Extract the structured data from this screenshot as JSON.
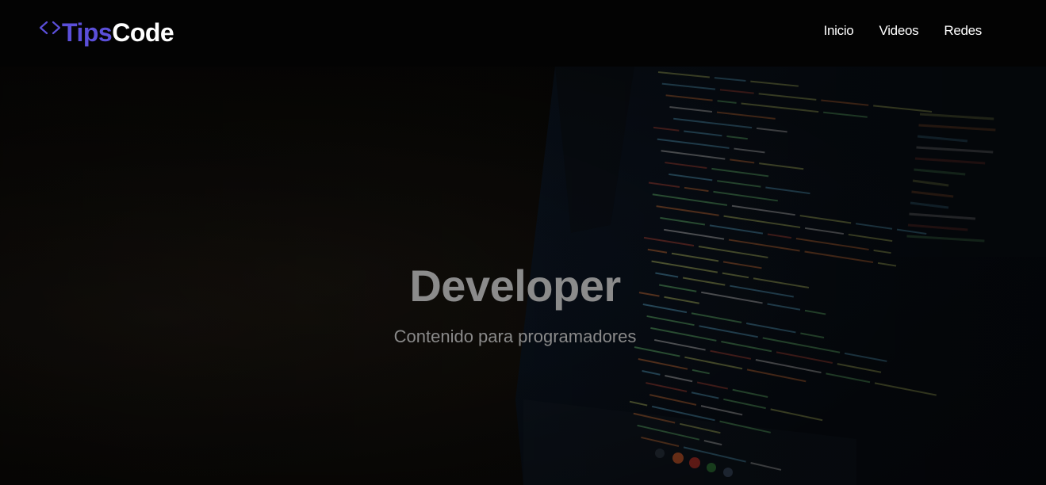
{
  "brand": {
    "icon": "code-brackets-icon",
    "name_part1": "Tips",
    "name_part2": "Code",
    "accent_color": "#5b4fd9"
  },
  "nav": {
    "items": [
      {
        "label": "Inicio"
      },
      {
        "label": "Videos"
      },
      {
        "label": "Redes"
      }
    ]
  },
  "hero": {
    "title": "Developer",
    "subtitle": "Contenido para programadores",
    "background": "dark photo of a laptop screen showing HTML source code"
  }
}
